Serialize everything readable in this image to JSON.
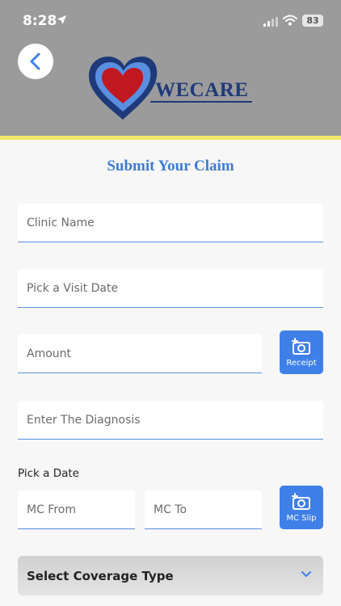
{
  "status_bar": {
    "time": "8:28",
    "battery": "83"
  },
  "header": {
    "logo_text": "WECARE"
  },
  "page": {
    "title": "Submit Your Claim"
  },
  "form": {
    "clinic_name": "Clinic Name",
    "visit_date": "Pick a Visit Date",
    "amount": "Amount",
    "receipt_button": "Receipt",
    "diagnosis": "Enter The Diagnosis",
    "date_section_label": "Pick a Date",
    "mc_from": "MC From",
    "mc_to": "MC To",
    "mc_slip_button": "MC Slip",
    "coverage_type": "Select Coverage Type"
  },
  "colors": {
    "accent": "#3f7fe8",
    "title": "#3d7bd6",
    "header_bg": "#9b9b9b",
    "stripe": "#f4e86a",
    "logo_navy": "#1e3a7a",
    "logo_red": "#c0181e"
  }
}
